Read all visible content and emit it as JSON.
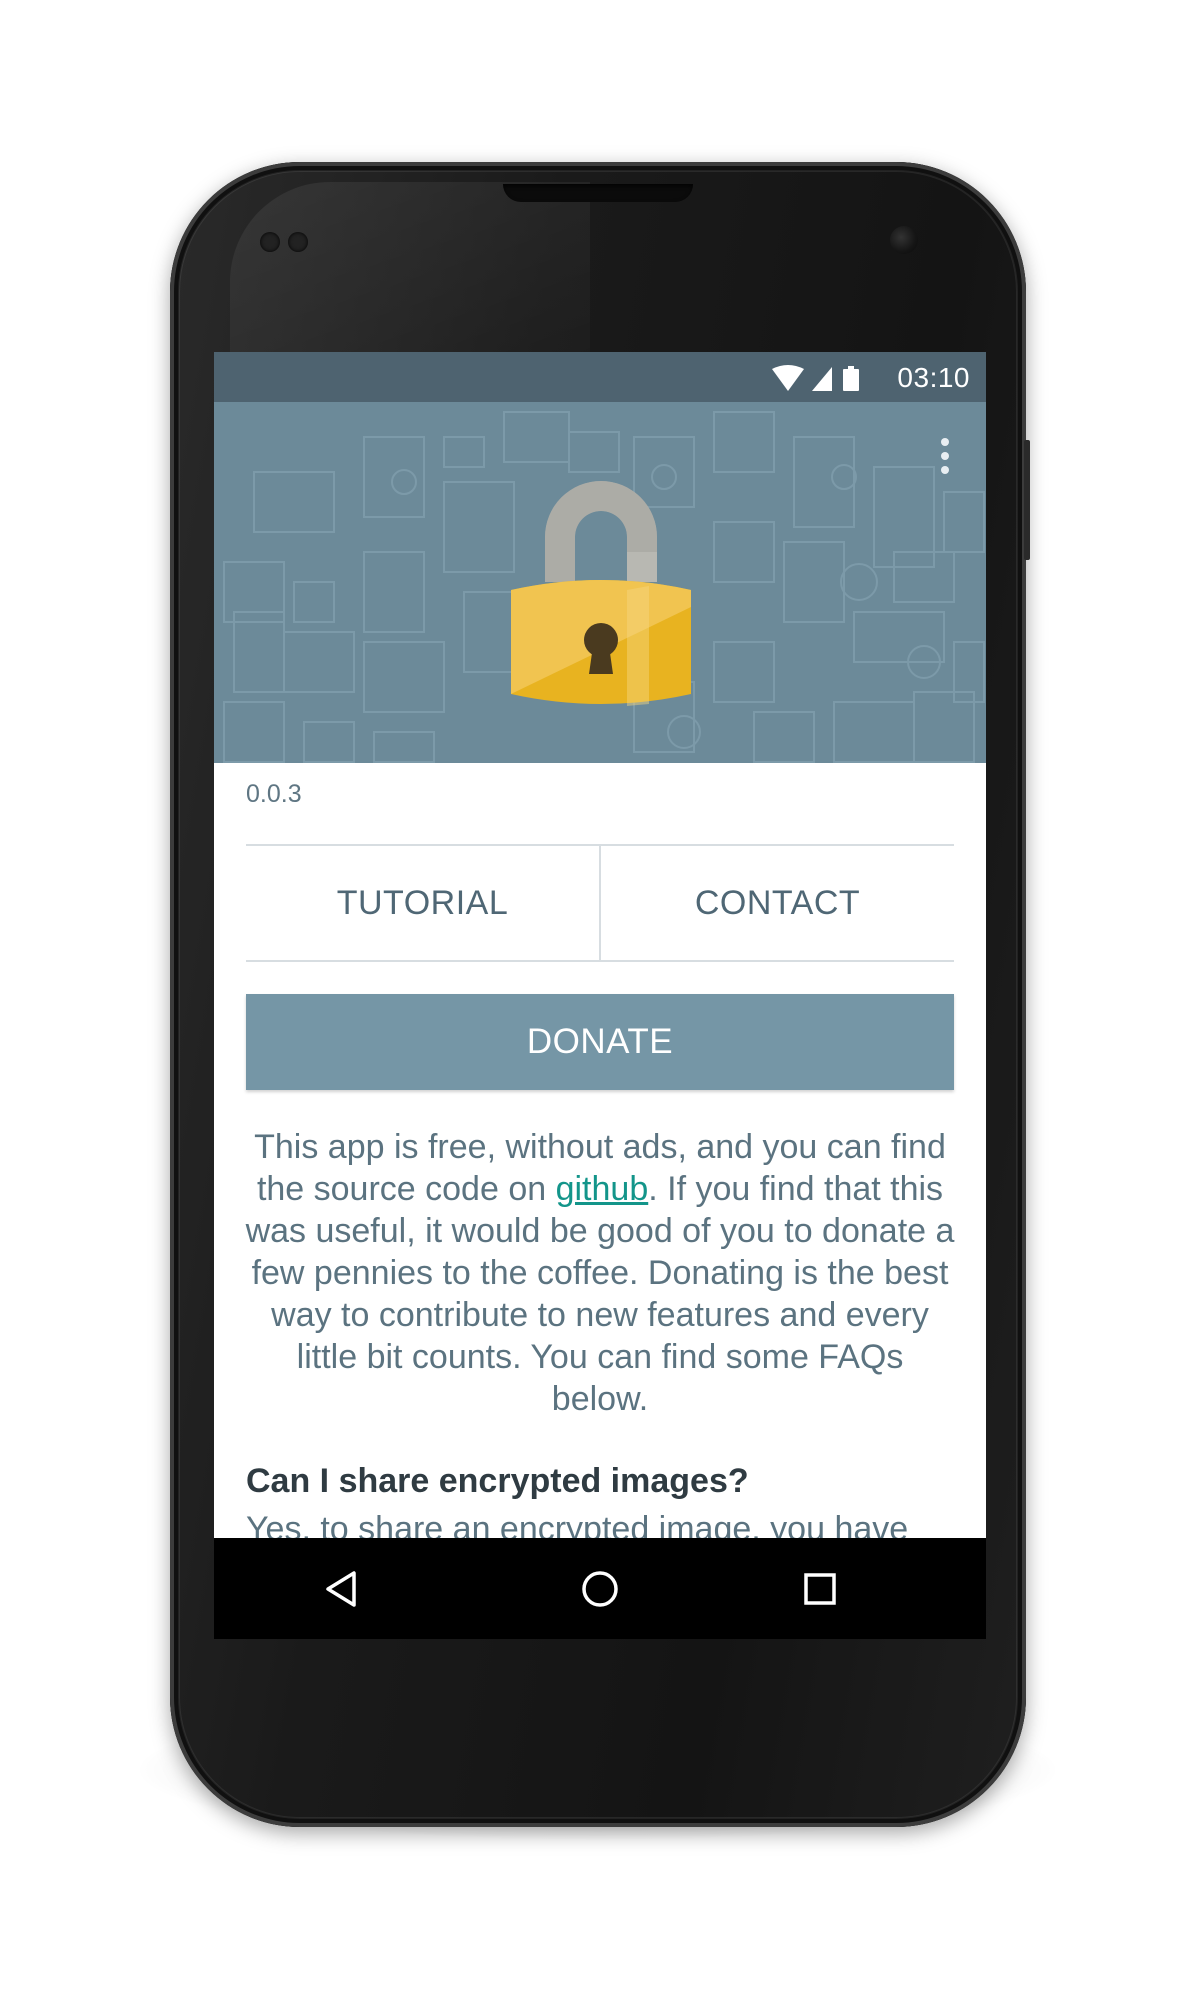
{
  "status_bar": {
    "time": "03:10",
    "icons": [
      "wifi-icon",
      "cell-signal-icon",
      "battery-icon"
    ]
  },
  "toolbar": {
    "overflow_icon": "more-vert-icon"
  },
  "header": {
    "illustration": "unlocked-padlock-icon",
    "background_color": "#6c8a99"
  },
  "app": {
    "version": "0.0.3"
  },
  "tabs": [
    {
      "label": "TUTORIAL"
    },
    {
      "label": "CONTACT"
    }
  ],
  "donate": {
    "label": "DONATE",
    "color": "#7596a6"
  },
  "about": {
    "text_before_link": "This app is free, without ads, and you can find the source code on ",
    "link_text": "github",
    "text_after_link": ". If you find that this was useful, it would be good of you to donate a few pennies to the coffee. Donating is the best way to contribute to new features and every little bit counts. You can find some FAQs below.",
    "link_color": "#13958a"
  },
  "faq": [
    {
      "question": "Can I share encrypted images?",
      "answer_visible": "Yes, to share an encrypted image, you have"
    }
  ],
  "nav_bar": {
    "buttons": [
      "back-icon",
      "home-icon",
      "recents-icon"
    ]
  }
}
